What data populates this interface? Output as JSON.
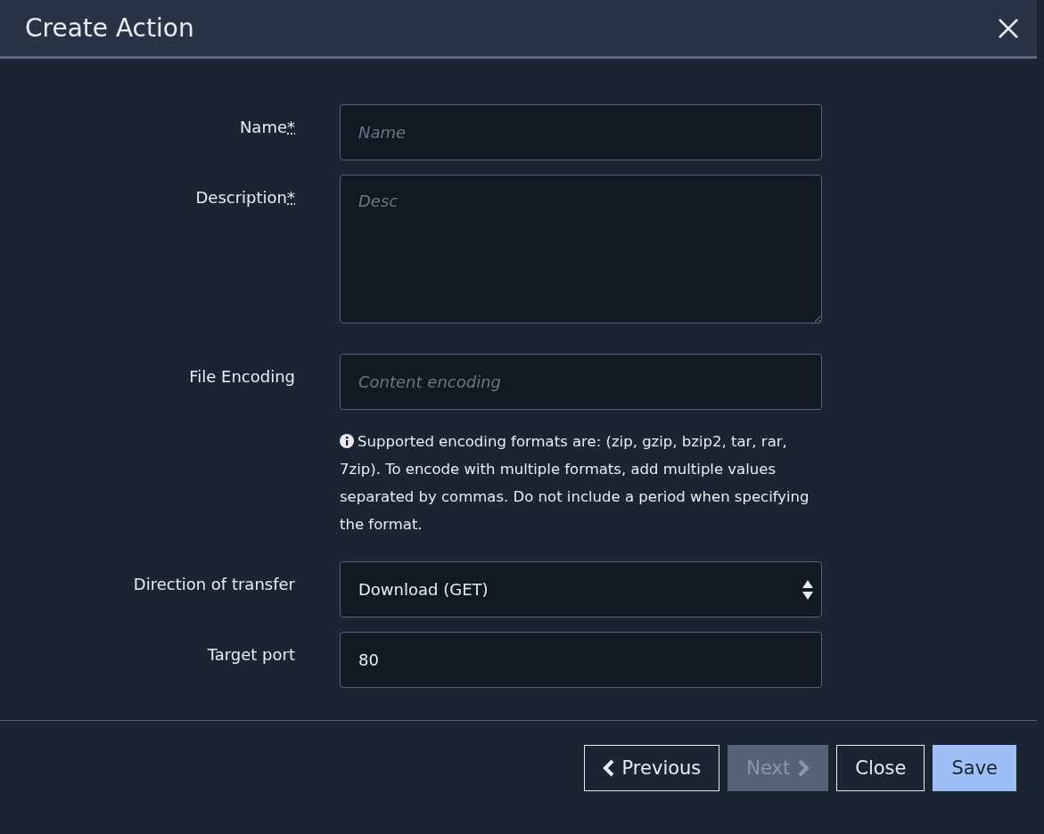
{
  "dialog": {
    "title": "Create Action"
  },
  "fields": [
    {
      "kind": "input",
      "label": "Name",
      "required_mark": "*",
      "placeholder": "Name"
    },
    {
      "kind": "textarea",
      "label": "Description",
      "required_mark": "*",
      "placeholder": "Desc"
    },
    {
      "kind": "input",
      "label": "File Encoding",
      "placeholder": "Content encoding",
      "help": "Supported encoding formats are: (zip, gzip, bzip2, tar, rar, 7zip). To encode with multiple formats, add multiple values separated by commas. Do not include a period when specifying the format."
    },
    {
      "kind": "select",
      "label": "Direction of transfer",
      "value": "Download (GET)"
    },
    {
      "kind": "input",
      "label": "Target port",
      "value": "80"
    }
  ],
  "buttons": [
    {
      "label": "Previous",
      "kind": "prev",
      "disabled": false
    },
    {
      "label": "Next",
      "kind": "next",
      "disabled": true
    },
    {
      "label": "Close",
      "kind": "plain",
      "disabled": false
    },
    {
      "label": "Save",
      "kind": "primary",
      "disabled": false
    }
  ]
}
